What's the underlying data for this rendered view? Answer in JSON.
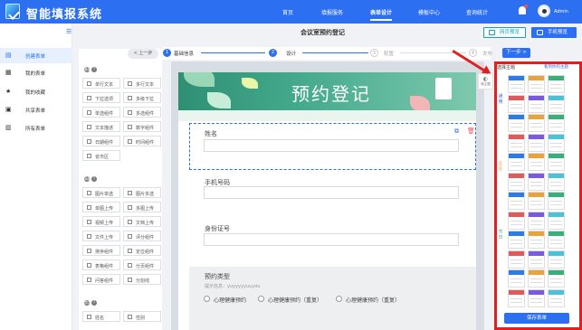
{
  "app": {
    "name": "智能填报系统"
  },
  "topnav": {
    "items": [
      {
        "label": "首页"
      },
      {
        "label": "填报服务"
      },
      {
        "label": "表单设计",
        "active": true
      },
      {
        "label": "模板中心"
      },
      {
        "label": "查询统计"
      }
    ],
    "user": "Admin"
  },
  "sidebar": {
    "items": [
      {
        "label": "创建表单",
        "icon": "file-icon",
        "active": true
      },
      {
        "label": "我的表单",
        "icon": "grid-icon"
      },
      {
        "label": "我的收藏",
        "icon": "star-icon"
      },
      {
        "label": "共享表单",
        "icon": "share-icon"
      },
      {
        "label": "所有表单",
        "icon": "folder-icon"
      }
    ]
  },
  "page": {
    "title": "会议室预约登记",
    "preview_web": "网页预览",
    "preview_mobile": "手机预览"
  },
  "steps": {
    "prev": "< 上一步",
    "next": "下一步 >",
    "items": [
      {
        "num": "1",
        "label": "基础信息",
        "state": "done"
      },
      {
        "num": "2",
        "label": "设计",
        "state": "current"
      },
      {
        "num": "3",
        "label": "配置",
        "state": "todo"
      },
      {
        "num": "4",
        "label": "发布",
        "state": "todo"
      }
    ]
  },
  "components": {
    "basic_title": "基础组件",
    "basic": [
      "单行文本",
      "多行文本",
      "下拉选项",
      "多级下拉",
      "单选组件",
      "多选组件",
      "文本描述",
      "数字组件",
      "日期组件",
      "时间组件",
      "省市区"
    ],
    "advanced_title": "高级组件",
    "advanced": [
      "图片单选",
      "图片多选",
      "单图上传",
      "多图上传",
      "视频上传",
      "文档上传",
      "文件上传",
      "评分组件",
      "排序组件",
      "定位组件",
      "表格组件",
      "分页组件",
      "问答组件",
      "分割线"
    ],
    "common_title": "常用组件",
    "common": [
      "姓名",
      "性别"
    ]
  },
  "form": {
    "banner_title": "预约登记",
    "fields": [
      {
        "label": "姓名"
      },
      {
        "label": "手机号码"
      },
      {
        "label": "身份证号"
      }
    ],
    "question": {
      "label": "预约类型",
      "hint": "提示信息：yuyyyyyuuyou",
      "options": [
        "心理健康预约",
        "心理健康预约（重复）",
        "心理健康预约（重复）"
      ]
    }
  },
  "theme_switch": {
    "label": "换主题"
  },
  "theme_panel": {
    "title": "选择主题",
    "link": "看到你的主题",
    "categories": [
      "通用",
      "企业",
      "节日"
    ],
    "save": "保存表单",
    "colors": [
      "#2d7be5",
      "#e8a33d",
      "#39b07a",
      "#e05a5a",
      "#7a5ae0",
      "#4cc2d8"
    ]
  }
}
